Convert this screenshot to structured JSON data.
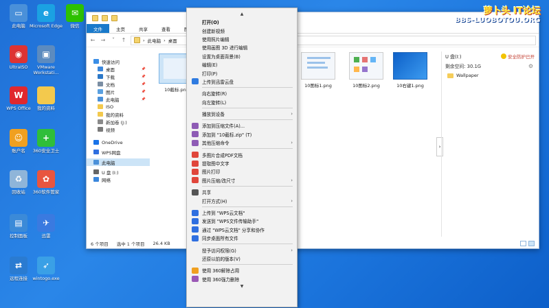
{
  "desktop": {
    "icons": [
      {
        "label": "此电脑",
        "icon": "computer-icon",
        "color": "#4a90d9"
      },
      {
        "label": "Microsoft Edge",
        "icon": "edge-icon",
        "color": "#1ba1e2"
      },
      {
        "label": "微信",
        "icon": "wechat-icon",
        "color": "#2dc100"
      },
      {
        "label": "UltraISO",
        "icon": "disc-icon",
        "color": "#d33"
      },
      {
        "label": "VMware Workstati...",
        "icon": "vmware-icon",
        "color": "#5c8bbf"
      },
      {
        "label": "WPS Office",
        "icon": "wps-icon",
        "color": "#e0282e"
      },
      {
        "label": "我的资料",
        "icon": "folder-icon",
        "color": "#f3c94d"
      },
      {
        "label": "账户名",
        "icon": "user-icon",
        "color": "#f0a020"
      },
      {
        "label": "360安全卫士",
        "icon": "shield-360-icon",
        "color": "#2fbe3a"
      },
      {
        "label": "回收站",
        "icon": "recycle-bin-icon",
        "color": "#8fb5d9"
      },
      {
        "label": "360软件管家",
        "icon": "app-manager-icon",
        "color": "#e8553f"
      },
      {
        "label": "控制面板",
        "icon": "control-panel-icon",
        "color": "#3b8ad8"
      },
      {
        "label": "迅雷",
        "icon": "thunder-icon",
        "color": "#3a7ae0"
      },
      {
        "label": "远程连接",
        "icon": "remote-icon",
        "color": "#2a7bd1"
      },
      {
        "label": "wintogo.exe",
        "icon": "wintogo-icon",
        "color": "#3aa0e6"
      }
    ]
  },
  "explorer": {
    "tabs": [
      "文件",
      "主页",
      "共享",
      "查看",
      "图片"
    ],
    "breadcrumb": [
      "此电脑",
      "桌面"
    ],
    "sidebar": [
      {
        "label": "快速访问",
        "icon": "star-icon",
        "color": "#3a8ee6",
        "pin": false
      },
      {
        "label": "桌面",
        "icon": "desktop-icon",
        "color": "#3b87dc",
        "pin": true
      },
      {
        "label": "下载",
        "icon": "download-icon",
        "color": "#2c78c8",
        "pin": true
      },
      {
        "label": "文档",
        "icon": "document-icon",
        "color": "#7b8ea3",
        "pin": true
      },
      {
        "label": "图片",
        "icon": "picture-icon",
        "color": "#5aa0e0",
        "pin": true
      },
      {
        "label": "此电脑",
        "icon": "computer-icon",
        "color": "#4a90d9",
        "pin": true
      },
      {
        "label": "ISO",
        "icon": "folder-icon",
        "color": "#f3c94d",
        "pin": false
      },
      {
        "label": "我的资料",
        "icon": "folder-icon",
        "color": "#f3c94d",
        "pin": false
      },
      {
        "label": "新加卷 (J:)",
        "icon": "drive-icon",
        "color": "#8a8a8a",
        "pin": false
      },
      {
        "label": "视频",
        "icon": "video-icon",
        "color": "#7a7a7a",
        "pin": false
      },
      {
        "label": "OneDrive",
        "icon": "cloud-icon",
        "color": "#1a73e8",
        "pin": false
      },
      {
        "label": "WPS网盘",
        "icon": "cloud-icon",
        "color": "#2f6fe0",
        "pin": false
      },
      {
        "label": "此电脑",
        "icon": "computer-icon",
        "color": "#4a90d9",
        "pin": false,
        "selected": true
      },
      {
        "label": "U 盘 (I:)",
        "icon": "usb-drive-icon",
        "color": "#666",
        "pin": false
      },
      {
        "label": "网络",
        "icon": "network-icon",
        "color": "#3b87dc",
        "pin": false
      }
    ],
    "files": [
      "10截标.png",
      "10图标1.png",
      "10图标2.png",
      "10右键1.png"
    ],
    "status": {
      "count": "6 个项目",
      "selected": "选中 1 个项目",
      "size": "26.4 KB"
    },
    "preview": {
      "drive": "U 盘(I:)",
      "safe": "安全防护已开",
      "free_label": "剩余空间: 30.1G",
      "folder": "Wallpaper"
    }
  },
  "context_menu": {
    "items": [
      {
        "label": "打开(O)",
        "bold": true
      },
      {
        "label": "创建新视频"
      },
      {
        "label": "使用照片编辑"
      },
      {
        "label": "使用画图 3D 进行编辑"
      },
      {
        "label": "设置为桌面背景(B)"
      },
      {
        "label": "编辑(E)"
      },
      {
        "label": "打印(P)"
      },
      {
        "label": "上传到迅雷云盘",
        "icon": "thunder-cloud-icon",
        "iconColor": "#2f7be0"
      },
      {
        "sep": true
      },
      {
        "label": "向右旋转(R)"
      },
      {
        "label": "向左旋转(L)"
      },
      {
        "sep": true
      },
      {
        "label": "播放到设备",
        "sub": true
      },
      {
        "sep": true
      },
      {
        "label": "添加到压缩文件(A)...",
        "icon": "archive-icon",
        "iconColor": "#8e5bb5"
      },
      {
        "label": "添加到 \"10截标.zip\" (T)",
        "icon": "archive-icon",
        "iconColor": "#8e5bb5"
      },
      {
        "label": "其他压缩命令",
        "icon": "archive-icon",
        "iconColor": "#8e5bb5",
        "sub": true
      },
      {
        "sep": true
      },
      {
        "label": "多图片合成PDF文档",
        "icon": "pdf-icon",
        "iconColor": "#e0463b"
      },
      {
        "label": "提取图中文字",
        "icon": "ocr-icon",
        "iconColor": "#e0463b"
      },
      {
        "label": "图片打印",
        "icon": "print-icon",
        "iconColor": "#e0463b"
      },
      {
        "label": "图片压缩/改尺寸",
        "icon": "compress-icon",
        "iconColor": "#e0463b",
        "sub": true
      },
      {
        "sep": true
      },
      {
        "label": "共享",
        "icon": "share-icon",
        "iconColor": "#555"
      },
      {
        "label": "打开方式(H)",
        "sub": true
      },
      {
        "sep": true
      },
      {
        "label": "上传到 \"WPS云文档\"",
        "icon": "wps-cloud-icon",
        "iconColor": "#2f6fe0"
      },
      {
        "label": "发送到 \"WPS文件传输助手\"",
        "icon": "send-icon",
        "iconColor": "#2f6fe0"
      },
      {
        "label": "通过 \"WPS云文档\" 分享和协作",
        "icon": "collab-icon",
        "iconColor": "#2f6fe0"
      },
      {
        "label": "同步桌面所有文件",
        "icon": "sync-icon",
        "iconColor": "#2f6fe0"
      },
      {
        "sep": true
      },
      {
        "label": "授予访问权限(G)",
        "sub": true
      },
      {
        "label": "还原以前的版本(V)"
      },
      {
        "sep": true
      },
      {
        "label": "使用 360解除占用",
        "icon": "unlock-360-icon",
        "iconColor": "#f0a020"
      },
      {
        "label": "使用 360强力删除",
        "icon": "delete-360-icon",
        "iconColor": "#9b59b6"
      }
    ]
  },
  "logo": {
    "top": "萝卜头 IT论坛",
    "bottom": "BBS-LUOBOTOU.ORG"
  }
}
